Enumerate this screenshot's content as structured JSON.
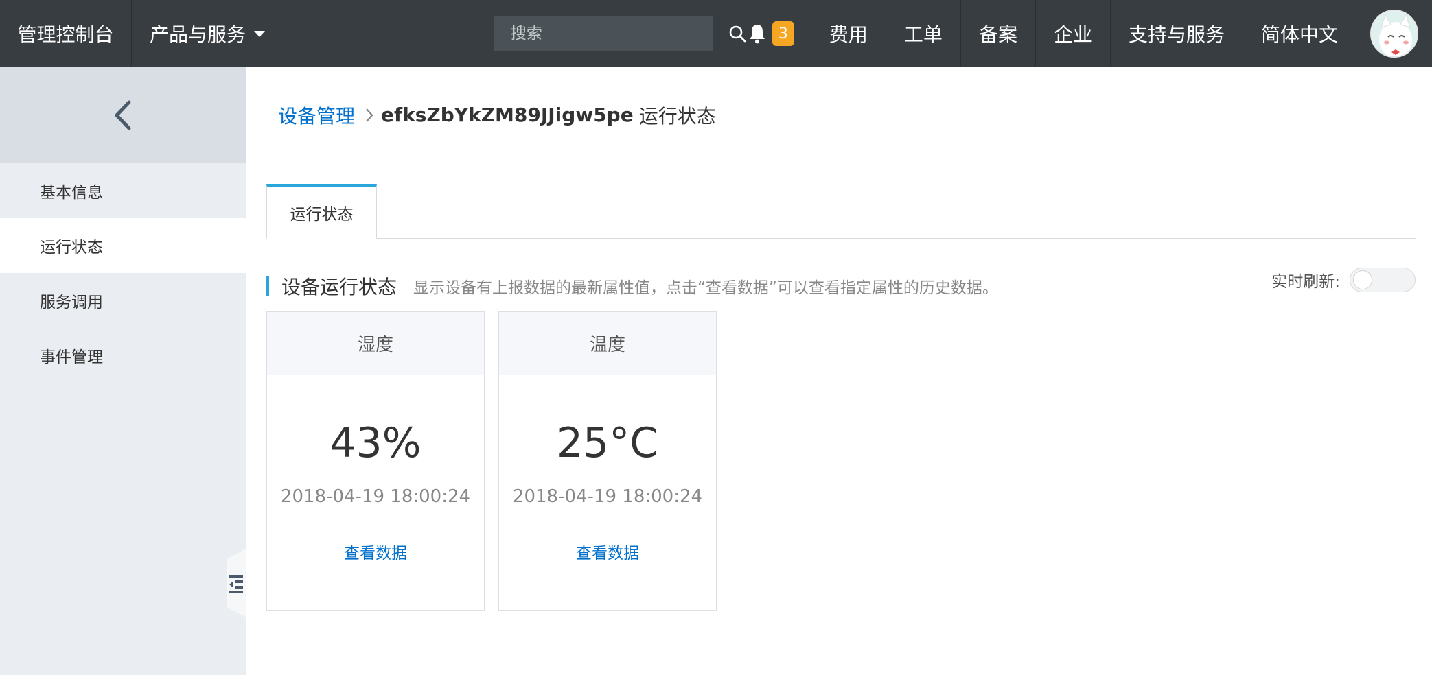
{
  "topbar": {
    "brand": "管理控制台",
    "products": "产品与服务",
    "search_placeholder": "搜索",
    "notification_count": "3",
    "links": [
      "费用",
      "工单",
      "备案",
      "企业",
      "支持与服务",
      "简体中文"
    ]
  },
  "sidebar": {
    "items": [
      {
        "label": "基本信息",
        "active": false
      },
      {
        "label": "运行状态",
        "active": true
      },
      {
        "label": "服务调用",
        "active": false
      },
      {
        "label": "事件管理",
        "active": false
      }
    ]
  },
  "breadcrumb": {
    "parent": "设备管理",
    "device": "efksZbYkZM89JJigw5pe",
    "page": "运行状态"
  },
  "tabs": [
    "运行状态"
  ],
  "section": {
    "title": "设备运行状态",
    "description": "显示设备有上报数据的最新属性值，点击“查看数据”可以查看指定属性的历史数据。",
    "realtime_label": "实时刷新:",
    "realtime_on": false
  },
  "cards": [
    {
      "name": "湿度",
      "value": "43%",
      "time": "2018-04-19 18:00:24",
      "link": "查看数据"
    },
    {
      "name": "温度",
      "value": "25°C",
      "time": "2018-04-19 18:00:24",
      "link": "查看数据"
    }
  ],
  "colors": {
    "topbar_bg": "#373d41",
    "accent": "#2aa6de",
    "link": "#0070cc",
    "badge": "#f5a623"
  }
}
